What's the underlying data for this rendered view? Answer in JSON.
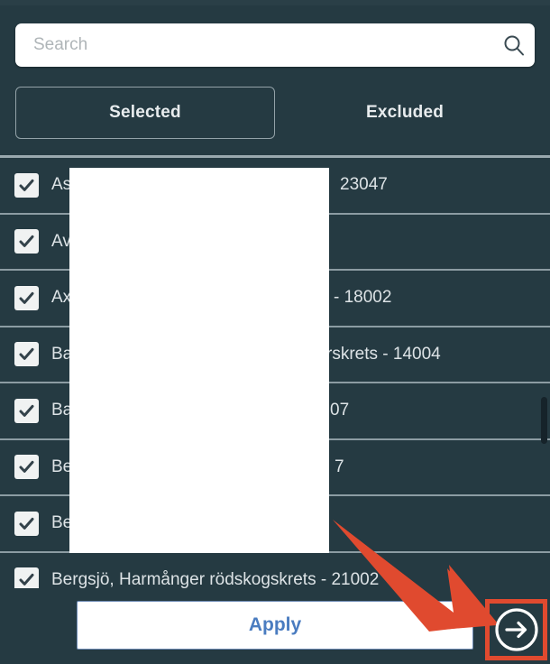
{
  "window": {
    "background_color": "#253A42",
    "accent_color": "#4A7CC0",
    "annotation_color": "#E04A2F"
  },
  "search": {
    "value": "",
    "placeholder": "Search",
    "icon": "search-icon"
  },
  "tabs": [
    {
      "label": "Selected",
      "active": true
    },
    {
      "label": "Excluded",
      "active": false
    }
  ],
  "list": {
    "rows": [
      {
        "label": "As",
        "suffix": "23047",
        "checked": true
      },
      {
        "label": "Av",
        "suffix": "",
        "checked": true
      },
      {
        "label": "Ax",
        "suffix": "- 18002",
        "checked": true
      },
      {
        "label": "Ba",
        "suffix": "rskrets - 14004",
        "checked": true
      },
      {
        "label": "Ba",
        "suffix": "07",
        "checked": true
      },
      {
        "label": "Be",
        "suffix": "7",
        "checked": true
      },
      {
        "label": "Be",
        "suffix": "",
        "checked": true
      },
      {
        "label": "Bergsjö, Harmånger rödskogskrets - 21002",
        "suffix": "",
        "checked": true
      }
    ]
  },
  "footer": {
    "apply_label": "Apply",
    "forward_icon": "arrow-right-circle-icon"
  },
  "annotations": {
    "arrow": "red-pointer-arrow",
    "highlight": "red-highlight-box"
  }
}
